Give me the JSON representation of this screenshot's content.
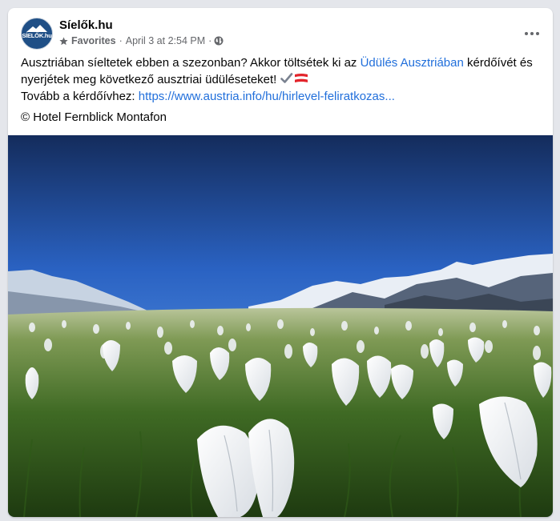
{
  "post": {
    "page_name": "Síelők.hu",
    "avatar_text": "SÍELŐK.hu",
    "audience": "Favorites",
    "separator": "·",
    "date": "April 3 at 2:54 PM",
    "separator2": "·",
    "more_label": "More options",
    "text_part1": "Ausztriában síeltetek ebben a szezonban? Akkor töltsétek ki az ",
    "link_label": "Üdülés Ausztriában",
    "text_part2": " kérdőívét és",
    "text_line2": "nyerjétek meg következő ausztriai üdüléseteket! ",
    "text_line3_prefix": "Tovább a kérdőívhez: ",
    "url": "https://www.austria.info/hu/hirlevel-feliratkozas...",
    "credit": "© Hotel Fernblick Montafon"
  },
  "icons": {
    "star": "star-icon",
    "globe": "globe-icon",
    "more": "more-horizontal-icon",
    "check": "check-mark-icon",
    "flag": "austria-flag-icon"
  },
  "colors": {
    "link": "#216fdb",
    "meta": "#65676b",
    "austria_red": "#e3242b"
  }
}
